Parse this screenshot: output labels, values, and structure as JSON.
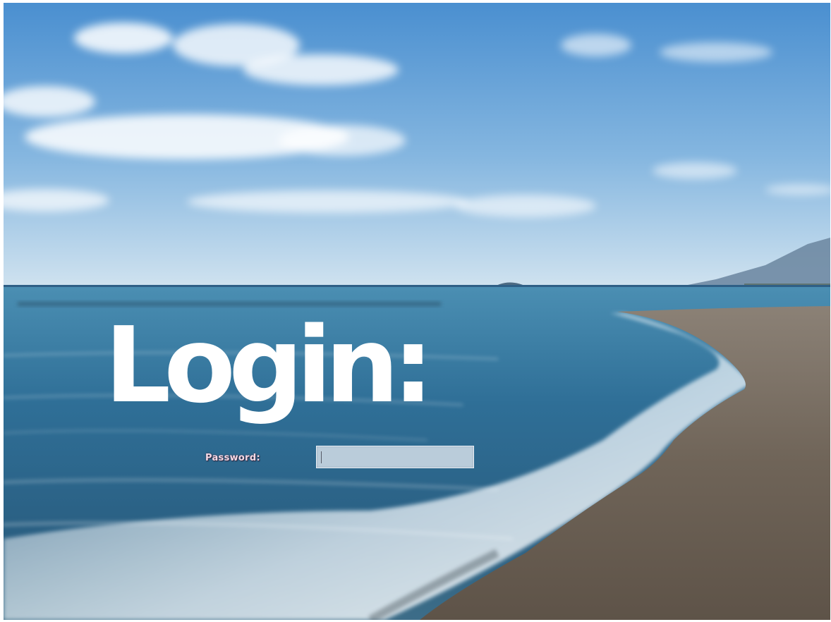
{
  "login": {
    "title": "Login:",
    "password_label": "Password:",
    "password_value": ""
  },
  "colors": {
    "title": "#ffffff",
    "label": "#f3d9e6",
    "sky_top": "#4a8fd0",
    "sea": "#2f6f97",
    "beach": "#6f6458"
  }
}
